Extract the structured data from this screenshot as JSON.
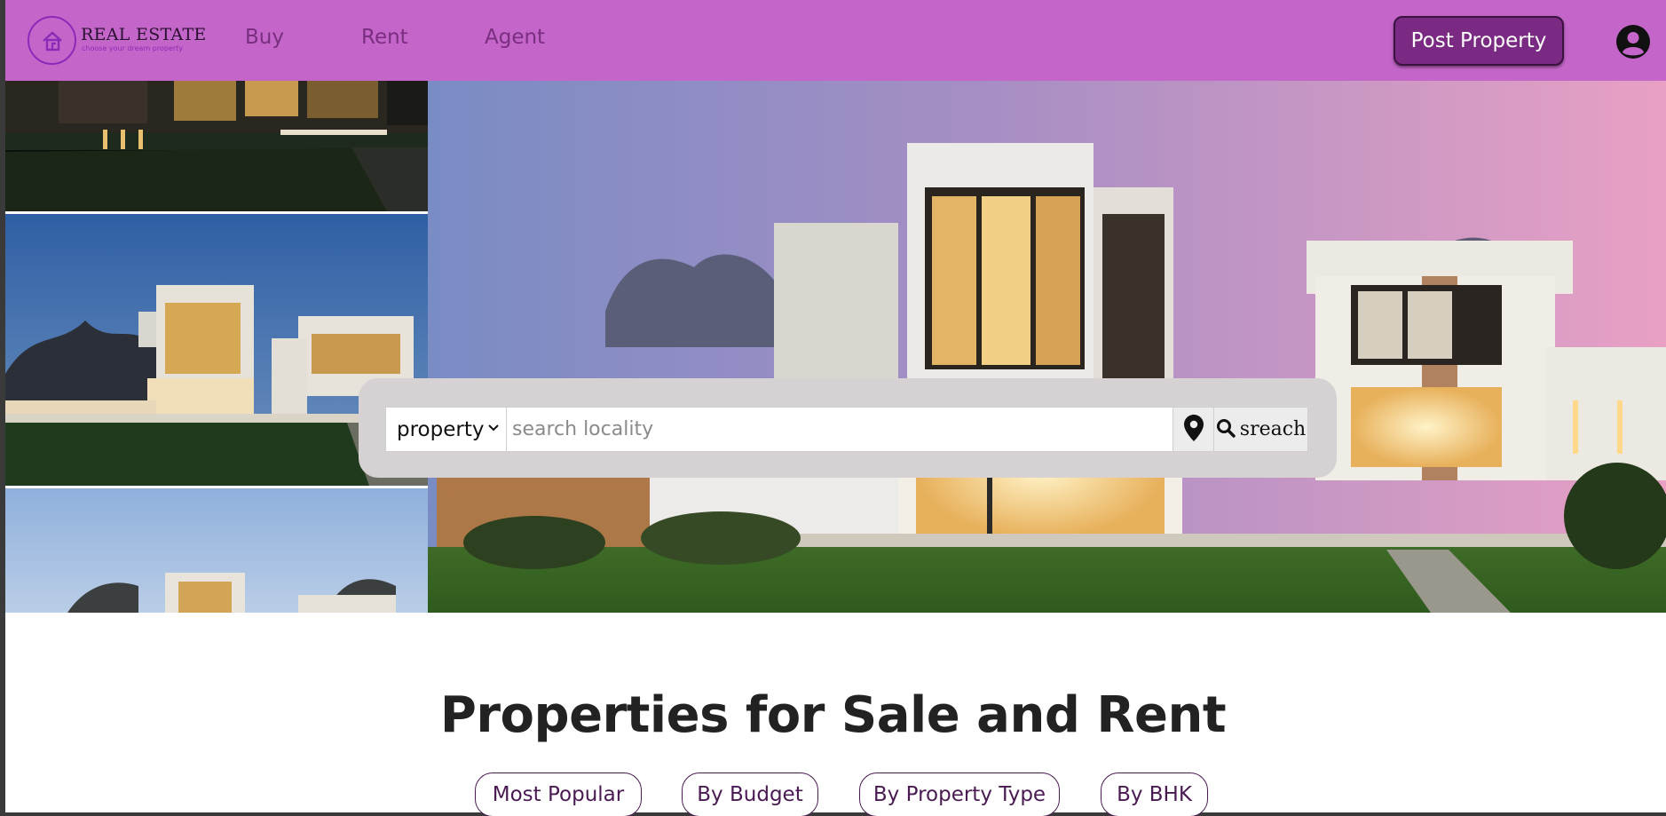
{
  "brand": {
    "name": "REAL ESTATE",
    "tagline": "choose your dream property",
    "accent": "#c466c9",
    "button_color": "#7a2a82"
  },
  "nav": {
    "links": [
      "Buy",
      "Rent",
      "Agent"
    ],
    "post_button": "Post Property",
    "account_icon": "user-circle-icon"
  },
  "search": {
    "type_value": "property",
    "placeholder": "search locality",
    "location_icon": "map-pin-icon",
    "button_label": "sreach",
    "button_icon": "search-icon"
  },
  "section": {
    "title": "Properties for Sale and Rent",
    "filters": [
      "Most Popular",
      "By Budget",
      "By Property Type",
      "By BHK"
    ]
  }
}
